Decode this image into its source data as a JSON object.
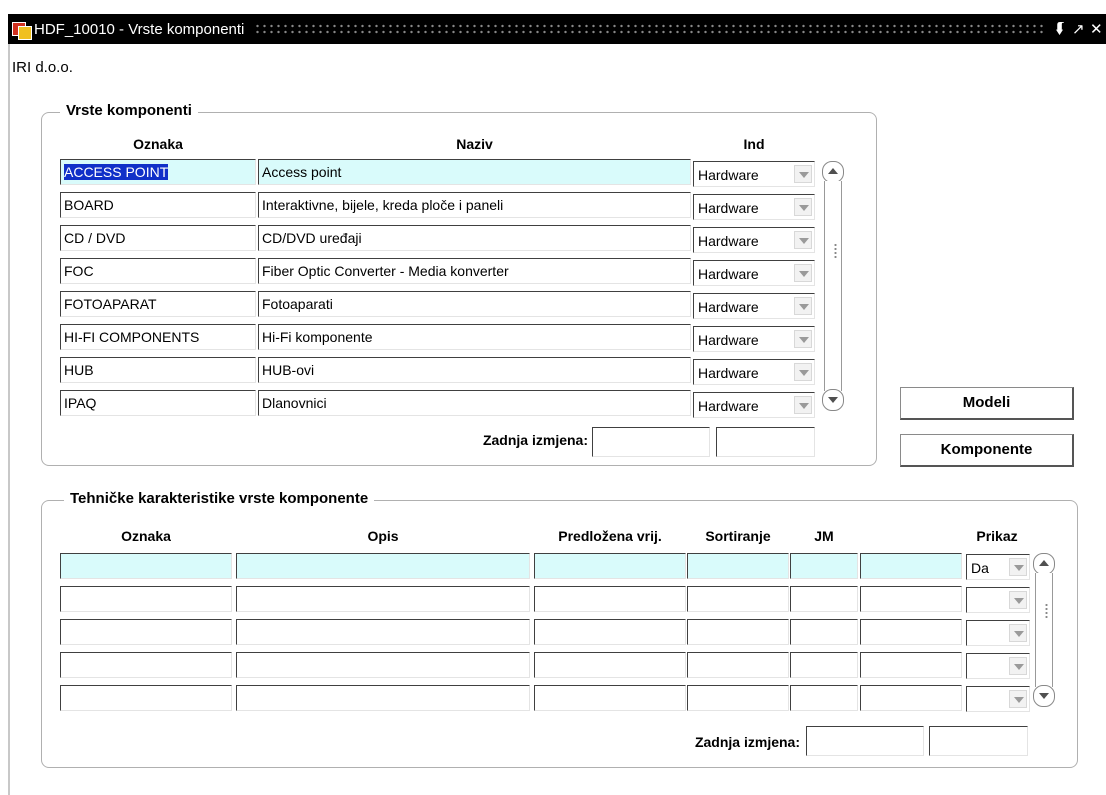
{
  "window": {
    "title": "HDF_10010 - Vrste komponenti",
    "controls": [
      "minimize-icon",
      "maximize-icon",
      "close-icon"
    ]
  },
  "company": "IRI d.o.o.",
  "vrste": {
    "frame_title": "Vrste komponenti",
    "columns": {
      "oznaka": "Oznaka",
      "naziv": "Naziv",
      "ind": "Ind"
    },
    "rows": [
      {
        "oznaka": "ACCESS POINT",
        "naziv": "Access point",
        "ind": "Hardware"
      },
      {
        "oznaka": "BOARD",
        "naziv": "Interaktivne, bijele, kreda ploče i paneli",
        "ind": "Hardware"
      },
      {
        "oznaka": "CD / DVD",
        "naziv": "CD/DVD uređaji",
        "ind": "Hardware"
      },
      {
        "oznaka": "FOC",
        "naziv": "Fiber Optic Converter - Media konverter",
        "ind": "Hardware"
      },
      {
        "oznaka": "FOTOAPARAT",
        "naziv": "Fotoaparati",
        "ind": "Hardware"
      },
      {
        "oznaka": "HI-FI COMPONENTS",
        "naziv": "Hi-Fi komponente",
        "ind": "Hardware"
      },
      {
        "oznaka": "HUB",
        "naziv": "HUB-ovi",
        "ind": "Hardware"
      },
      {
        "oznaka": "IPAQ",
        "naziv": "Dlanovnici",
        "ind": "Hardware"
      }
    ],
    "zadnja_label": "Zadnja izmjena:",
    "zadnja_value1": "",
    "zadnja_value2": ""
  },
  "buttons": {
    "modeli": "Modeli",
    "komponente": "Komponente"
  },
  "tehnicke": {
    "frame_title": "Tehničke karakteristike vrste komponente",
    "columns": {
      "oznaka": "Oznaka",
      "opis": "Opis",
      "predlozena": "Predložena vrij.",
      "sortiranje": "Sortiranje",
      "jm": "JM",
      "prikaz": "Prikaz"
    },
    "rows": [
      {
        "prikaz": "Da"
      },
      {
        "prikaz": ""
      },
      {
        "prikaz": ""
      },
      {
        "prikaz": ""
      },
      {
        "prikaz": ""
      }
    ],
    "zadnja_label": "Zadnja izmjena:",
    "zadnja_value1": "",
    "zadnja_value2": ""
  },
  "colors": {
    "active_row": "#d9fbfb",
    "selection": "#1030c8",
    "titlebar": "#000000"
  }
}
